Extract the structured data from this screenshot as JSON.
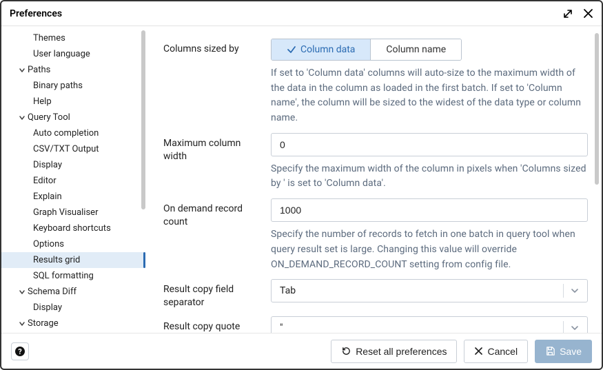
{
  "dialog": {
    "title": "Preferences"
  },
  "sidebar": {
    "nodes": [
      {
        "kind": "leaf",
        "level": 2,
        "label": "Themes",
        "key": "themes"
      },
      {
        "kind": "leaf",
        "level": 2,
        "label": "User language",
        "key": "user-language"
      },
      {
        "kind": "group",
        "level": 1,
        "label": "Paths",
        "key": "paths",
        "expanded": true
      },
      {
        "kind": "leaf",
        "level": 2,
        "label": "Binary paths",
        "key": "binary-paths"
      },
      {
        "kind": "leaf",
        "level": 2,
        "label": "Help",
        "key": "help"
      },
      {
        "kind": "group",
        "level": 1,
        "label": "Query Tool",
        "key": "query-tool",
        "expanded": true
      },
      {
        "kind": "leaf",
        "level": 2,
        "label": "Auto completion",
        "key": "auto-completion"
      },
      {
        "kind": "leaf",
        "level": 2,
        "label": "CSV/TXT Output",
        "key": "csv-txt-output"
      },
      {
        "kind": "leaf",
        "level": 2,
        "label": "Display",
        "key": "qt-display"
      },
      {
        "kind": "leaf",
        "level": 2,
        "label": "Editor",
        "key": "editor"
      },
      {
        "kind": "leaf",
        "level": 2,
        "label": "Explain",
        "key": "explain"
      },
      {
        "kind": "leaf",
        "level": 2,
        "label": "Graph Visualiser",
        "key": "graph-visualiser"
      },
      {
        "kind": "leaf",
        "level": 2,
        "label": "Keyboard shortcuts",
        "key": "keyboard-shortcuts"
      },
      {
        "kind": "leaf",
        "level": 2,
        "label": "Options",
        "key": "options"
      },
      {
        "kind": "leaf",
        "level": 2,
        "label": "Results grid",
        "key": "results-grid",
        "selected": true
      },
      {
        "kind": "leaf",
        "level": 2,
        "label": "SQL formatting",
        "key": "sql-formatting"
      },
      {
        "kind": "group",
        "level": 1,
        "label": "Schema Diff",
        "key": "schema-diff",
        "expanded": true
      },
      {
        "kind": "leaf",
        "level": 2,
        "label": "Display",
        "key": "sd-display"
      },
      {
        "kind": "group",
        "level": 1,
        "label": "Storage",
        "key": "storage",
        "expanded": true
      }
    ]
  },
  "fields": {
    "columns_sized_by": {
      "label": "Columns sized by",
      "options": [
        "Column data",
        "Column name"
      ],
      "selected": "Column data",
      "help": "If set to 'Column data' columns will auto-size to the maximum width of the data in the column as loaded in the first batch. If set to 'Column name', the column will be sized to the widest of the data type or column name."
    },
    "max_column_width": {
      "label": "Maximum column width",
      "value": "0",
      "help": "Specify the maximum width of the column in pixels when 'Columns sized by ' is set to 'Column data'."
    },
    "on_demand_count": {
      "label": "On demand record count",
      "value": "1000",
      "help": "Specify the number of records to fetch in one batch in query tool when query result set is large. Changing this value will override ON_DEMAND_RECORD_COUNT setting from config file."
    },
    "copy_field_sep": {
      "label": "Result copy field separator",
      "value": "Tab"
    },
    "copy_quote_char": {
      "label": "Result copy quote character",
      "value": "\""
    }
  },
  "footer": {
    "reset": "Reset all preferences",
    "cancel": "Cancel",
    "save": "Save"
  }
}
